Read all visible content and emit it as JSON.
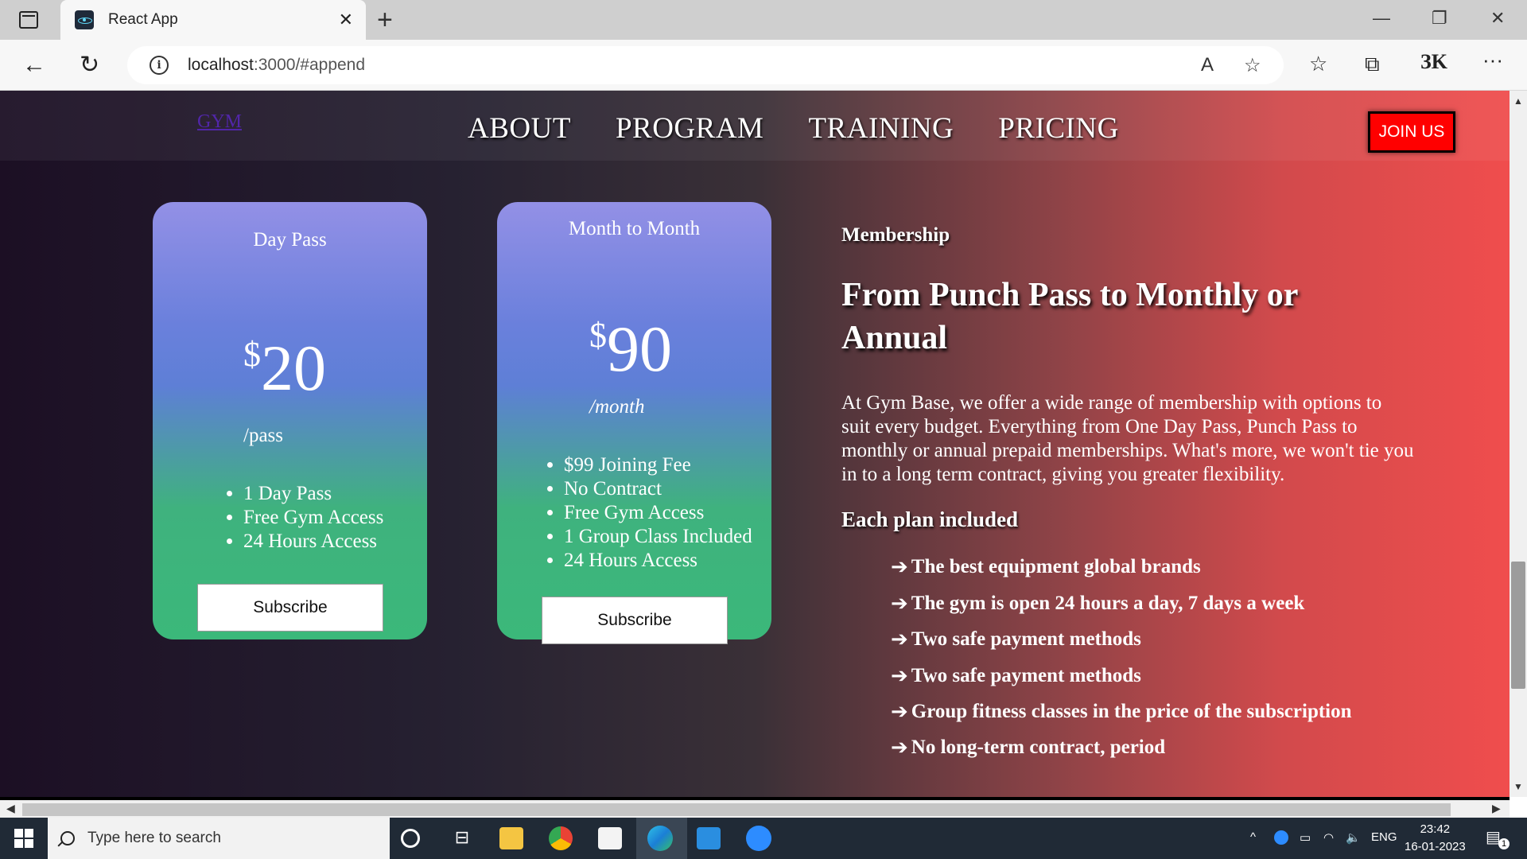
{
  "browser": {
    "tab_title": "React App",
    "url_host": "localhost",
    "url_rest": ":3000/#append"
  },
  "nav": {
    "logo": "GYM",
    "links": [
      "ABOUT",
      "PROGRAM",
      "TRAINING",
      "PRICING"
    ],
    "cta": "JOIN US"
  },
  "plans": [
    {
      "name": "Day Pass",
      "currency": "$",
      "price": "20",
      "unit": "/pass",
      "features": [
        "1 Day Pass",
        "Free Gym Access",
        "24 Hours Access"
      ],
      "button": "Subscribe"
    },
    {
      "name": "Month to Month",
      "currency": "$",
      "price": "90",
      "unit": "/month",
      "features": [
        "$99 Joining Fee",
        "No Contract",
        "Free Gym Access",
        "1 Group Class Included",
        "24 Hours Access"
      ],
      "button": "Subscribe"
    }
  ],
  "membership": {
    "kicker": "Membership",
    "headline": "From Punch Pass to Monthly or Annual",
    "paragraph": "At Gym Base, we offer a wide range of membership with options to suit every budget. Everything from One Day Pass, Punch Pass to monthly or annual prepaid memberships. What's more, we won't tie you in to a long term contract, giving you greater flexibility.",
    "included_title": "Each plan included",
    "included": [
      "The best equipment global brands",
      "The gym is open 24 hours a day, 7 days a week",
      "Two safe payment methods",
      "Two safe payment methods",
      "Group fitness classes in the price of the subscription",
      "No long-term contract, period"
    ]
  },
  "taskbar": {
    "search_placeholder": "Type here to search",
    "lang": "ENG",
    "time": "23:42",
    "date": "16-01-2023",
    "notification_count": "1"
  },
  "colors": {
    "cta_bg": "#ff0000",
    "card_top": "#9390e6",
    "card_bottom": "#3bb87a",
    "page_left": "#1c0f24",
    "page_right": "#f04d4d"
  }
}
